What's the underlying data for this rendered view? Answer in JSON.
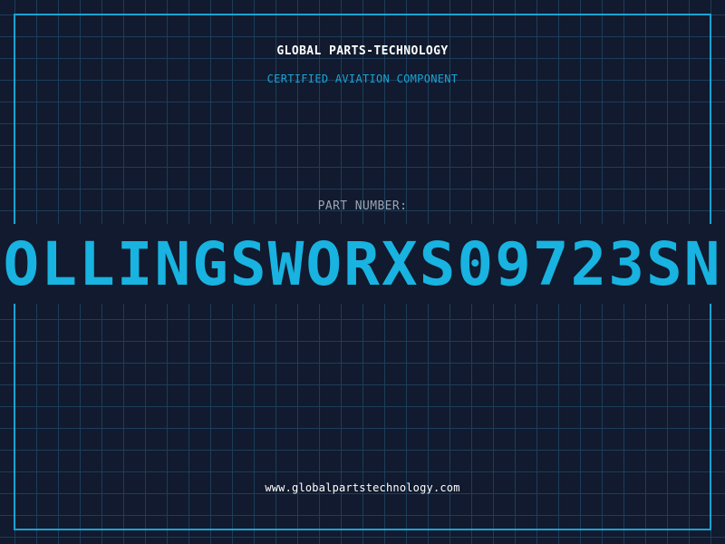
{
  "header": {
    "brand": "GLOBAL PARTS-TECHNOLOGY",
    "subtitle": "CERTIFIED AVIATION COMPONENT"
  },
  "part": {
    "label": "PART NUMBER:",
    "number": "OLLINGSWORXS09723SN"
  },
  "footer": {
    "website": "www.globalpartstechnology.com"
  },
  "colors": {
    "background": "#111a2e",
    "grid": "#1d3d5a",
    "accent": "#1aa3d6",
    "part_number": "#18b3e0",
    "text_primary": "#ffffff",
    "text_muted": "#9aa5b4"
  }
}
